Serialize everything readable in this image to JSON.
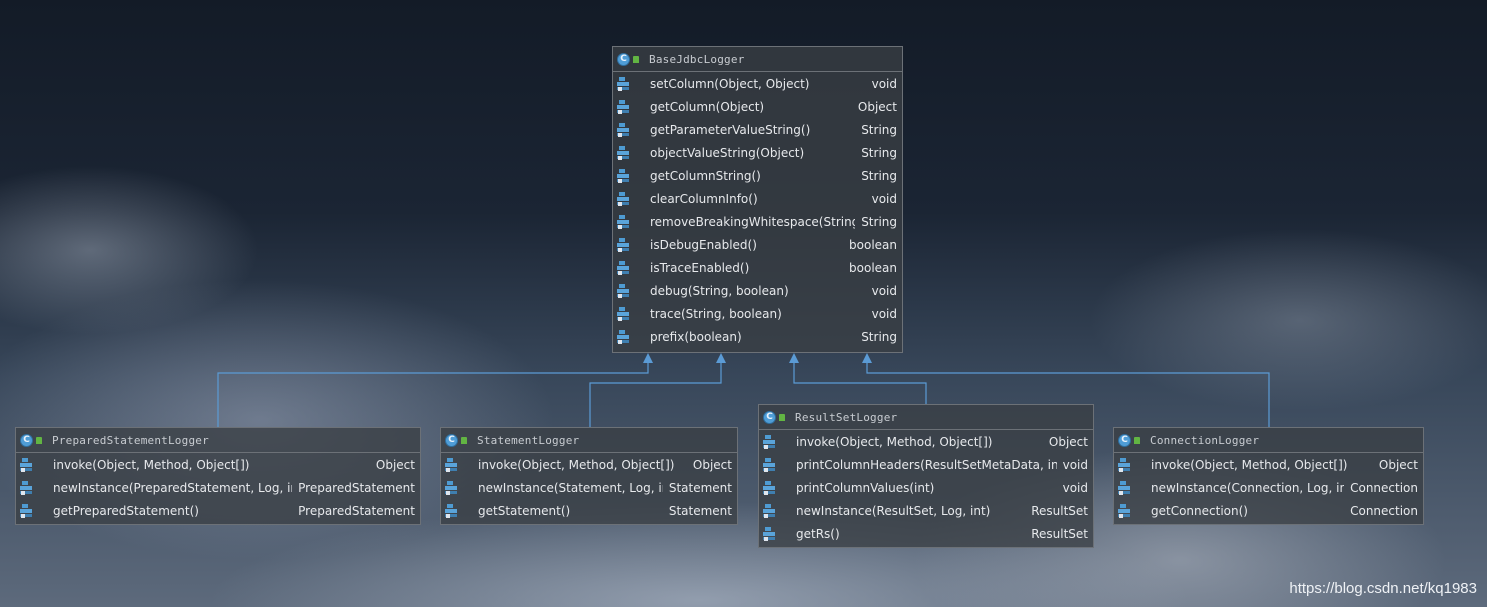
{
  "classes": {
    "base": {
      "name": "BaseJdbcLogger",
      "methods": [
        {
          "name": "setColumn(Object, Object)",
          "type": "void"
        },
        {
          "name": "getColumn(Object)",
          "type": "Object"
        },
        {
          "name": "getParameterValueString()",
          "type": "String"
        },
        {
          "name": "objectValueString(Object)",
          "type": "String"
        },
        {
          "name": "getColumnString()",
          "type": "String"
        },
        {
          "name": "clearColumnInfo()",
          "type": "void"
        },
        {
          "name": "removeBreakingWhitespace(String)",
          "type": "String"
        },
        {
          "name": "isDebugEnabled()",
          "type": "boolean"
        },
        {
          "name": "isTraceEnabled()",
          "type": "boolean"
        },
        {
          "name": "debug(String, boolean)",
          "type": "void"
        },
        {
          "name": "trace(String, boolean)",
          "type": "void"
        },
        {
          "name": "prefix(boolean)",
          "type": "String"
        }
      ]
    },
    "prepared": {
      "name": "PreparedStatementLogger",
      "methods": [
        {
          "name": "invoke(Object, Method, Object[])",
          "type": "Object"
        },
        {
          "name": "newInstance(PreparedStatement, Log, int)",
          "type": "PreparedStatement"
        },
        {
          "name": "getPreparedStatement()",
          "type": "PreparedStatement"
        }
      ]
    },
    "statement": {
      "name": "StatementLogger",
      "methods": [
        {
          "name": "invoke(Object, Method, Object[])",
          "type": "Object"
        },
        {
          "name": "newInstance(Statement, Log, int)",
          "type": "Statement"
        },
        {
          "name": "getStatement()",
          "type": "Statement"
        }
      ]
    },
    "resultset": {
      "name": "ResultSetLogger",
      "methods": [
        {
          "name": "invoke(Object, Method, Object[])",
          "type": "Object"
        },
        {
          "name": "printColumnHeaders(ResultSetMetaData, int)",
          "type": "void"
        },
        {
          "name": "printColumnValues(int)",
          "type": "void"
        },
        {
          "name": "newInstance(ResultSet, Log, int)",
          "type": "ResultSet"
        },
        {
          "name": "getRs()",
          "type": "ResultSet"
        }
      ]
    },
    "connection": {
      "name": "ConnectionLogger",
      "methods": [
        {
          "name": "invoke(Object, Method, Object[])",
          "type": "Object"
        },
        {
          "name": "newInstance(Connection, Log, int)",
          "type": "Connection"
        },
        {
          "name": "getConnection()",
          "type": "Connection"
        }
      ]
    }
  },
  "class_icon_letter": "C",
  "connector_color": "#5b9bd5",
  "watermark": "https://blog.csdn.net/kq1983"
}
